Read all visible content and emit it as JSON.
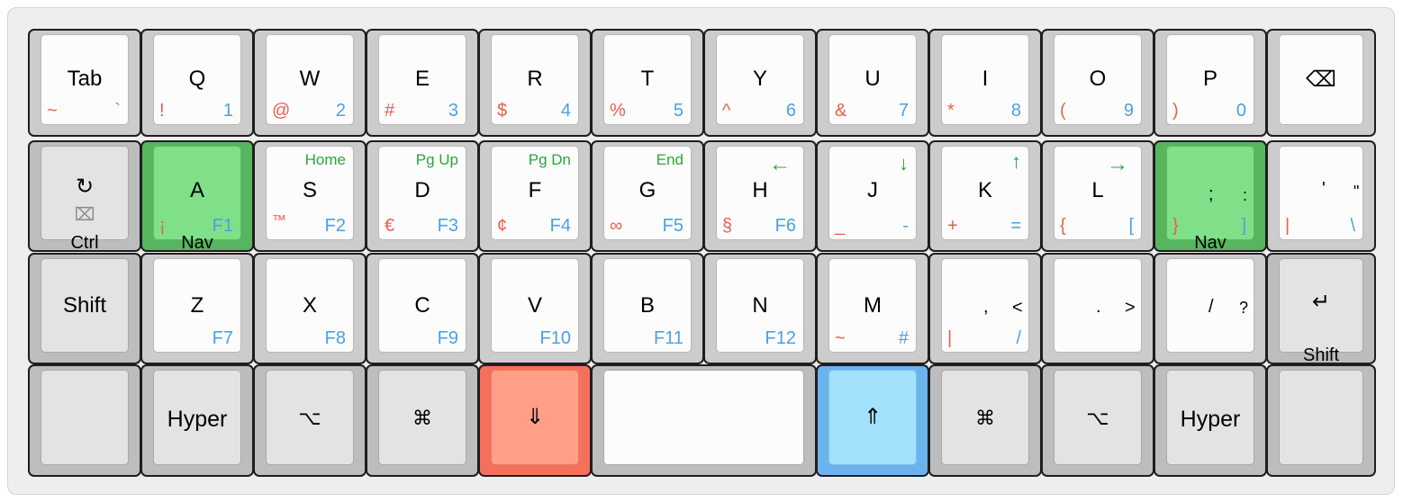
{
  "keys": {
    "tab": {
      "main": "Tab",
      "bl": "~",
      "br": "`"
    },
    "q": {
      "main": "Q",
      "bl": "!",
      "br": "1"
    },
    "w": {
      "main": "W",
      "bl": "@",
      "br": "2"
    },
    "e": {
      "main": "E",
      "bl": "#",
      "br": "3"
    },
    "r": {
      "main": "R",
      "bl": "$",
      "br": "4"
    },
    "t": {
      "main": "T",
      "bl": "%",
      "br": "5"
    },
    "y": {
      "main": "Y",
      "bl": "^",
      "br": "6"
    },
    "u": {
      "main": "U",
      "bl": "&",
      "br": "7"
    },
    "i": {
      "main": "I",
      "bl": "*",
      "br": "8"
    },
    "o": {
      "main": "O",
      "bl": "(",
      "br": "9"
    },
    "p": {
      "main": "P",
      "bl": ")",
      "br": "0"
    },
    "bksp": {
      "icon": "backspace-icon",
      "glyph": "⌫"
    },
    "ctrl": {
      "icon": "undo-icon",
      "glyph": "↻",
      "icon2": "clear-icon",
      "glyph2": "⌧",
      "hold": "Ctrl"
    },
    "a": {
      "main": "A",
      "bl": "¡",
      "br": "F1",
      "hold": "Nav"
    },
    "s": {
      "main": "S",
      "tr": "Home",
      "bl": "™",
      "br": "F2"
    },
    "d": {
      "main": "D",
      "tr": "Pg Up",
      "bl": "€",
      "br": "F3"
    },
    "f": {
      "main": "F",
      "tr": "Pg Dn",
      "bl": "¢",
      "br": "F4"
    },
    "g": {
      "main": "G",
      "tr": "End",
      "bl": "∞",
      "br": "F5"
    },
    "h": {
      "main": "H",
      "tr": "←",
      "bl": "§",
      "br": "F6"
    },
    "j": {
      "main": "J",
      "tr": "↓",
      "bl": "_",
      "br": "-"
    },
    "k": {
      "main": "K",
      "tr": "↑",
      "bl": "+",
      "br": "="
    },
    "l": {
      "main": "L",
      "tr": "→",
      "bl": "{",
      "br": "["
    },
    "semi": {
      "main": ";",
      "shift": ":",
      "bl": "}",
      "br": "]",
      "hold": "Nav"
    },
    "quote": {
      "main": "'",
      "shift": "\"",
      "bl": "|",
      "br": "\\"
    },
    "lshift": {
      "main": "Shift"
    },
    "z": {
      "main": "Z",
      "br": "F7"
    },
    "x": {
      "main": "X",
      "br": "F8"
    },
    "c": {
      "main": "C",
      "br": "F9"
    },
    "v": {
      "main": "V",
      "br": "F10"
    },
    "b": {
      "main": "B",
      "br": "F11"
    },
    "n": {
      "main": "N",
      "br": "F12"
    },
    "m": {
      "main": "M",
      "bl": "~",
      "br": "#"
    },
    "comma": {
      "main": ",",
      "shift": "<",
      "bl": "|",
      "br": "/"
    },
    "dot": {
      "main": ".",
      "shift": ">"
    },
    "slash": {
      "main": "/",
      "shift": "?"
    },
    "enter": {
      "icon": "return-icon",
      "glyph": "↵",
      "hold": "Shift"
    },
    "blank1": {},
    "hyper1": {
      "main": "Hyper"
    },
    "opt1": {
      "icon": "option-icon",
      "glyph": "⌥"
    },
    "cmd1": {
      "icon": "command-icon",
      "glyph": "⌘"
    },
    "lower": {
      "icon": "lower-layer-icon",
      "glyph": "⇓"
    },
    "space": {},
    "raise": {
      "icon": "raise-layer-icon",
      "glyph": "⇑"
    },
    "cmd2": {
      "icon": "command-icon",
      "glyph": "⌘"
    },
    "opt2": {
      "icon": "option-icon",
      "glyph": "⌥"
    },
    "hyper2": {
      "main": "Hyper"
    },
    "blank2": {}
  },
  "colors": {
    "layer_nav": "#7fe089",
    "layer_lower": "#ff9f87",
    "layer_raise": "#a3e1fd",
    "symbol_text": "#e8604e",
    "number_text": "#4fa0e0",
    "nav_text": "#2aa63a"
  }
}
